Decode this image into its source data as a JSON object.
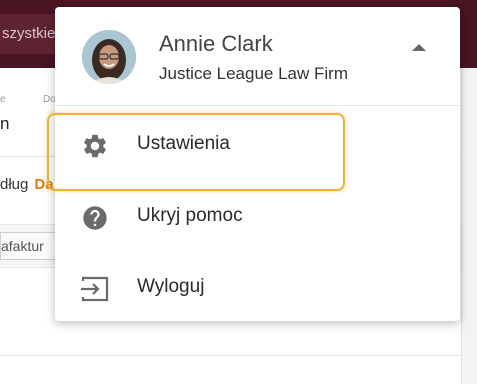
{
  "background": {
    "search_text": "szystkie",
    "sub_col1_label": "e",
    "sub_col1_value": "n",
    "sub_col2_label": "Do",
    "sort_label": "dług",
    "sort_active": "Da",
    "faktura_chip": "afaktur"
  },
  "user_menu": {
    "name": "Annie Clark",
    "firm": "Justice League Law Firm",
    "items": [
      {
        "label": "Ustawienia",
        "icon": "gear-icon"
      },
      {
        "label": "Ukryj pomoc",
        "icon": "help-circle-icon"
      },
      {
        "label": "Wyloguj",
        "icon": "logout-icon"
      }
    ]
  },
  "colors": {
    "topbar": "#4a1422",
    "accent_orange": "#e07a12",
    "highlight": "#f0b030",
    "icon_grey": "#6b6b6b"
  }
}
